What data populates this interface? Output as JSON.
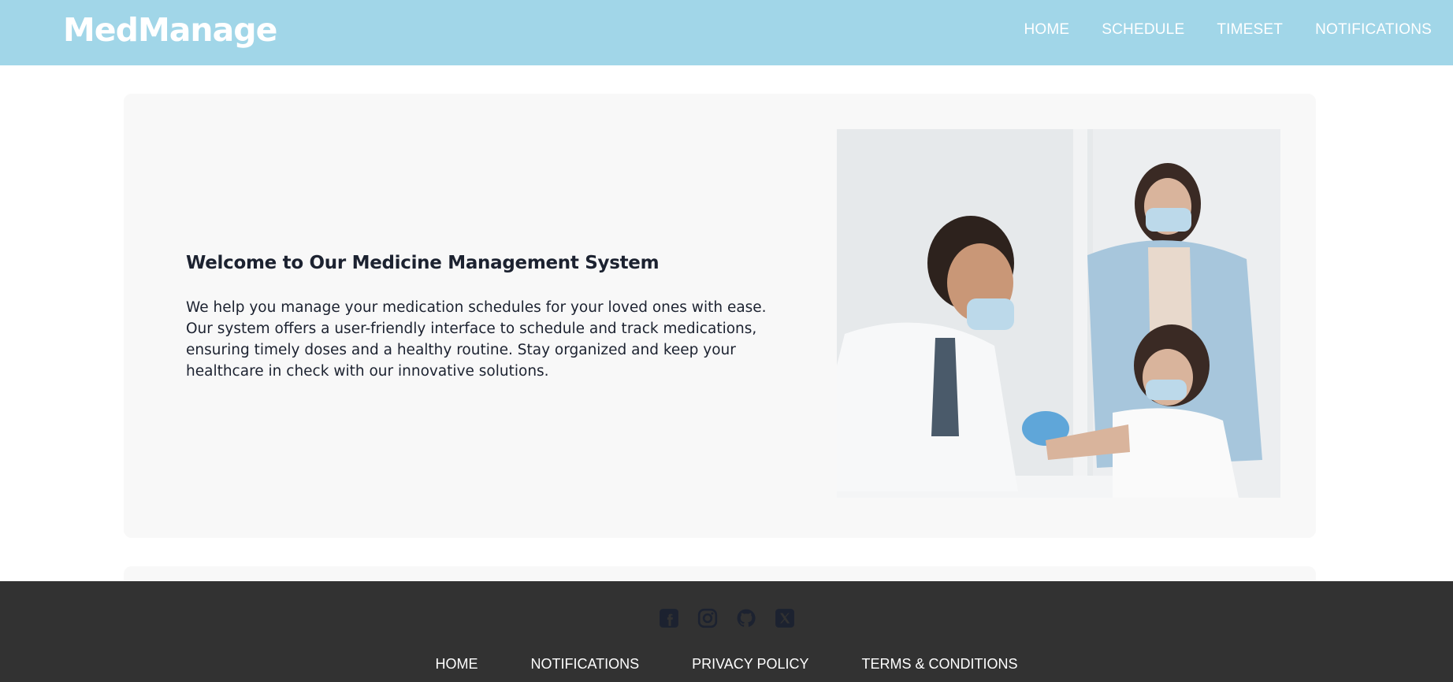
{
  "header": {
    "brand": "MedManage",
    "nav": [
      "HOME",
      "SCHEDULE",
      "TIMESET",
      "NOTIFICATIONS"
    ]
  },
  "hero": {
    "title": "Welcome to Our Medicine Management System",
    "text": "We help you manage your medication schedules for your loved ones with ease. Our system offers a user-friendly interface to schedule and track medications, ensuring timely doses and a healthy routine. Stay organized and keep your healthcare in check with our innovative solutions.",
    "image": "doctor-vaccinating-child-photo"
  },
  "footer": {
    "social_icons": [
      "facebook-icon",
      "instagram-icon",
      "github-icon",
      "x-twitter-icon"
    ],
    "links": [
      "HOME",
      "NOTIFICATIONS",
      "PRIVACY POLICY",
      "TERMS & CONDITIONS"
    ]
  },
  "colors": {
    "header_bg": "#a1d6e8",
    "card_bg": "#f8f8f8",
    "footer_bg": "#323232",
    "icon_color": "#1c2230"
  }
}
